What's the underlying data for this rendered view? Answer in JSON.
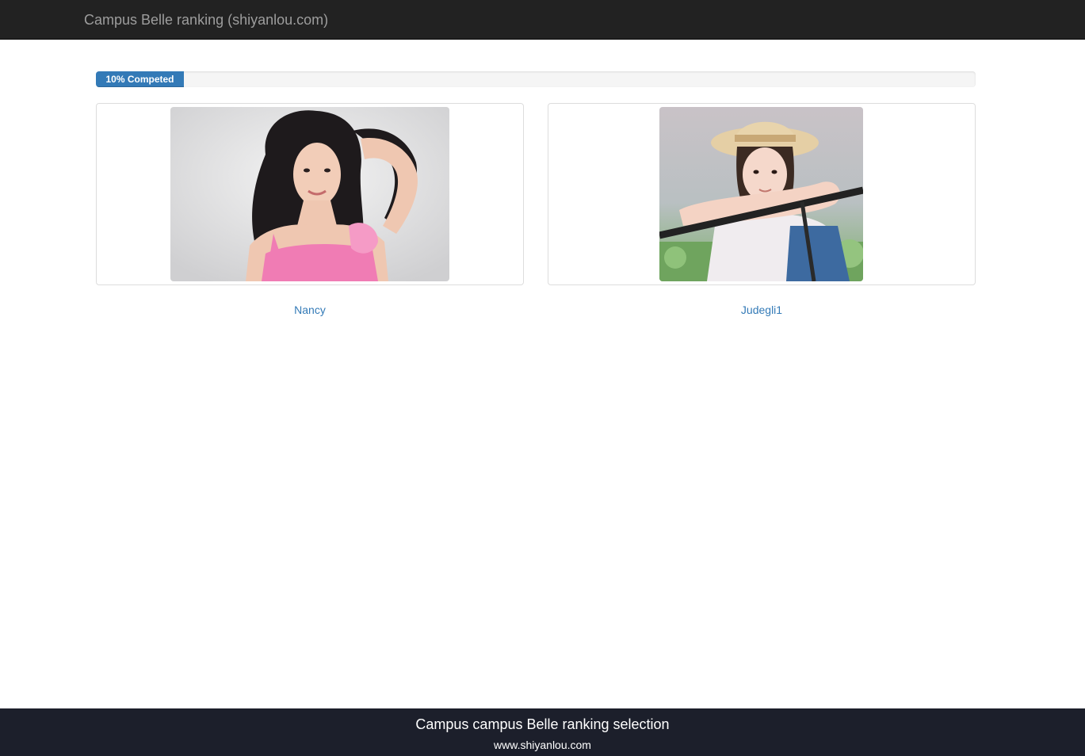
{
  "navbar": {
    "brand": "Campus Belle ranking (shiyanlou.com)"
  },
  "progress": {
    "label": "10% Competed",
    "value_percent": 10,
    "color": "#337ab7"
  },
  "candidates": [
    {
      "name": "Nancy",
      "photo": "portrait-photo"
    },
    {
      "name": "Judegli1",
      "photo": "portrait-photo"
    }
  ],
  "footer": {
    "title": "Campus campus Belle ranking selection",
    "url": "www.shiyanlou.com"
  },
  "colors": {
    "navbar_bg": "#222222",
    "footer_bg": "#1c1f2b",
    "link": "#337ab7"
  }
}
